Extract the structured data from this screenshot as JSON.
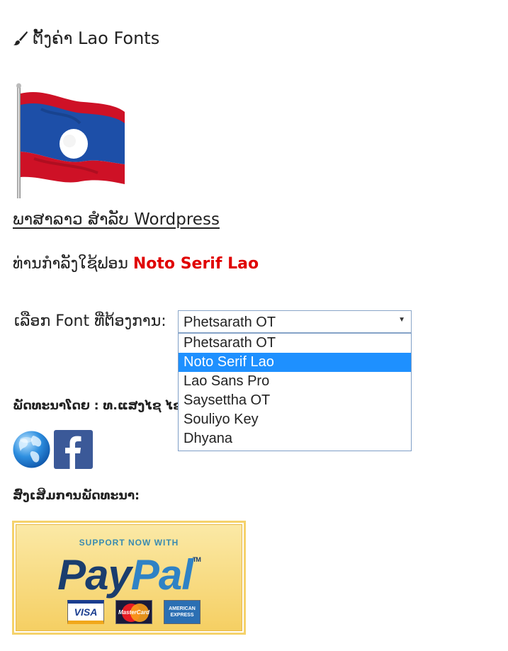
{
  "header": {
    "title": "ຕັ້ງຄ່າ Lao Fonts",
    "icon": "brush-icon"
  },
  "flag": {
    "icon": "lao-flag-icon",
    "colors": {
      "red": "#ce1126",
      "blue": "#002868",
      "white": "#ffffff"
    }
  },
  "wordpress_link": "ພາສາລາວ ສຳລັບ Wordpress",
  "current_font": {
    "prefix": "ທ່ານກຳລັງໃຊ້ຟອນ",
    "name": "Noto Serif Lao",
    "color": "#e00000"
  },
  "font_select": {
    "label": "ເລືອກ Font ທີ່ຕ້ອງການ:",
    "value": "Phetsarath OT",
    "options": [
      {
        "label": "Phetsarath OT",
        "highlighted": false
      },
      {
        "label": "Noto Serif Lao",
        "highlighted": true
      },
      {
        "label": "Lao Sans Pro",
        "highlighted": false
      },
      {
        "label": "Saysettha OT",
        "highlighted": false
      },
      {
        "label": "Souliyo Key",
        "highlighted": false
      },
      {
        "label": "Dhyana",
        "highlighted": false
      }
    ],
    "highlight_color": "#1e90ff"
  },
  "developer": {
    "label": "ພັດທະນາໂດຍ : ທ.ແສງໄຊ ໄຊ"
  },
  "social": {
    "website_icon": "globe-icon",
    "facebook_icon": "facebook-icon",
    "facebook_letter": "f",
    "facebook_color": "#3b5998"
  },
  "support": {
    "label": "ສົ່ງເສີມການພັດທະນາ:",
    "banner_top": "SUPPORT NOW WITH",
    "brand_part1": "Pay",
    "brand_part2": "Pal",
    "trademark": "TM",
    "cards": [
      "VISA",
      "MasterCard",
      "AMERICAN EXPRESS"
    ]
  }
}
